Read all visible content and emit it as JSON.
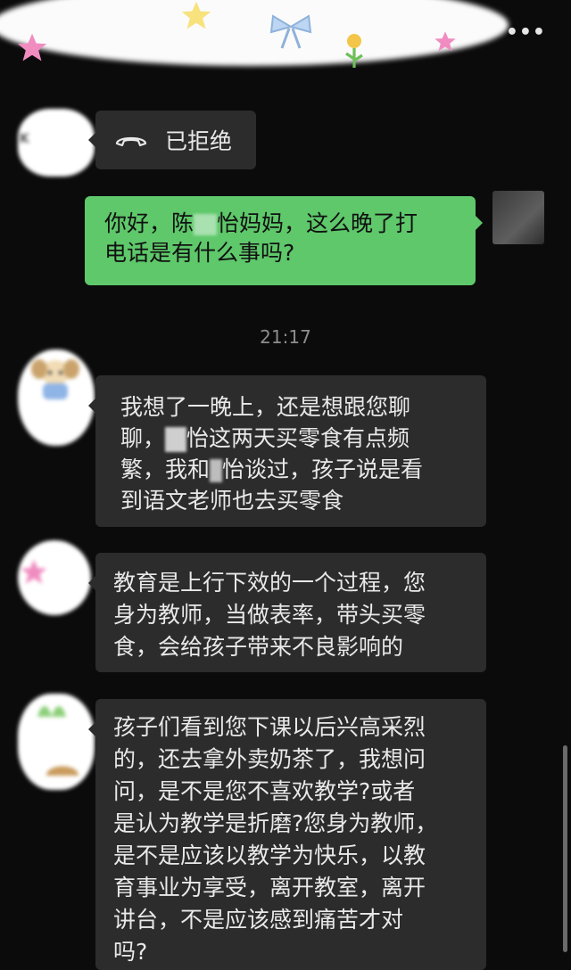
{
  "header": {
    "more_label": "•••"
  },
  "call_record": {
    "status_label": "已拒绝",
    "icon": "phone-hangup-icon"
  },
  "messages": [
    {
      "direction": "out",
      "lines": [
        "你好，陈",
        "怡妈妈，这么晚了打",
        "电话是有什么事吗?"
      ]
    },
    {
      "direction": "in",
      "lines": [
        "我想了一晚上，还是想跟您聊",
        "聊，",
        "怡这两天买零食有点频",
        "繁，我和",
        "怡谈过，孩子说是看",
        "到语文老师也去买零食"
      ]
    },
    {
      "direction": "in",
      "lines": [
        "教育是上行下效的一个过程，您",
        "身为教师，当做表率，带头买零",
        "食，会给孩子带来不良影响的"
      ]
    },
    {
      "direction": "in",
      "lines": [
        "孩子们看到您下课以后兴高采烈",
        "的，还去拿外卖奶茶了，我想问",
        "问，是不是您不喜欢教学?或者",
        "是认为教学是折磨?您身为教师，",
        "是不是应该以教学为快乐，以教",
        "育事业为享受，离开教室，离开",
        "讲台，不是应该感到痛苦才对",
        "吗?"
      ]
    }
  ],
  "timestamp": "21:17",
  "colors": {
    "background": "#0b0b0b",
    "incoming_bubble": "#2c2c2c",
    "outgoing_bubble": "#5ec86a",
    "text": "#e9e9e9"
  }
}
